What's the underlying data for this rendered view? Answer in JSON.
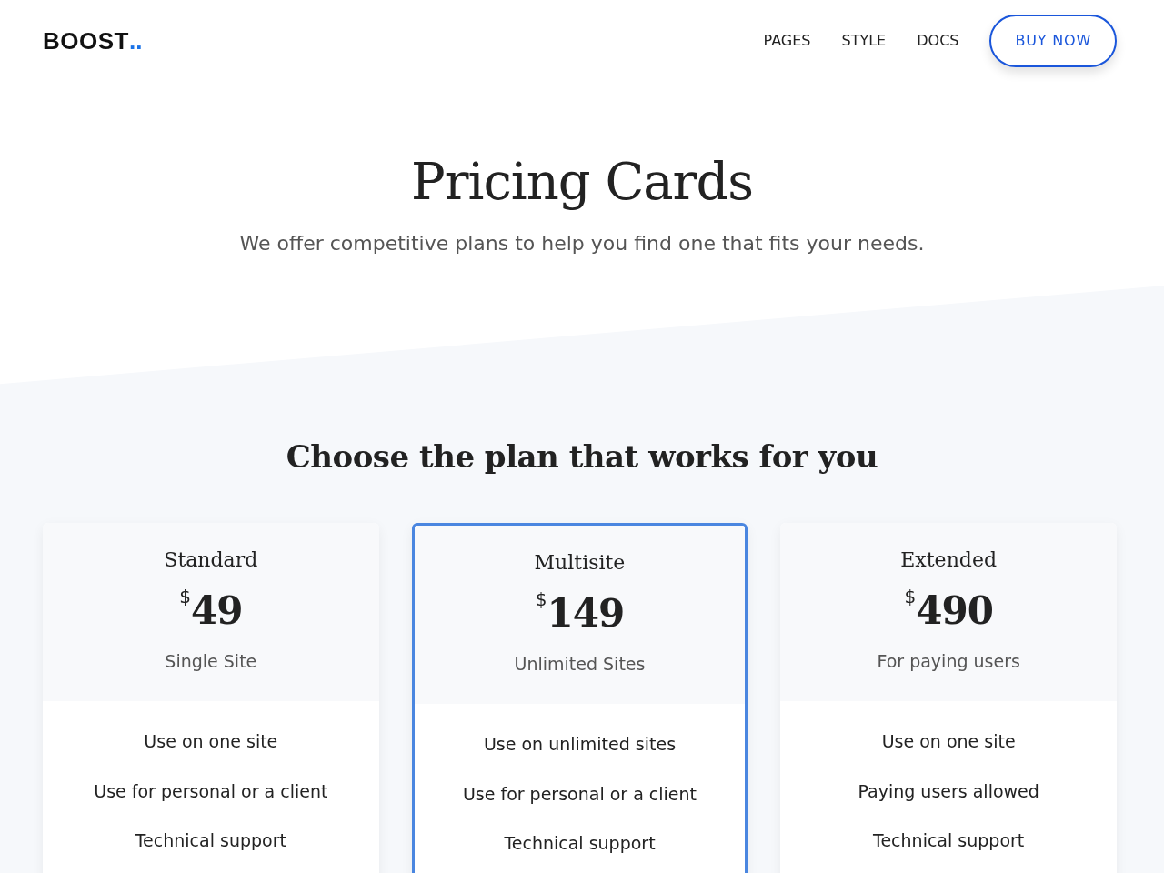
{
  "navbar": {
    "logo": "BOOST",
    "logo_dots": "..",
    "links": [
      "PAGES",
      "STYLE",
      "DOCS"
    ],
    "cta": "BUY NOW"
  },
  "hero": {
    "title": "Pricing Cards",
    "subtitle": "We offer competitive plans to help you find one that fits your needs."
  },
  "pricing": {
    "heading": "Choose the plan that works for you",
    "plans": [
      {
        "name": "Standard",
        "currency": "$",
        "price": "49",
        "caption": "Single Site",
        "featured": false,
        "features": [
          "Use on one site",
          "Use for personal or a client",
          "Technical support"
        ]
      },
      {
        "name": "Multisite",
        "currency": "$",
        "price": "149",
        "caption": "Unlimited Sites",
        "featured": true,
        "features": [
          "Use on unlimited sites",
          "Use for personal or a client",
          "Technical support"
        ]
      },
      {
        "name": "Extended",
        "currency": "$",
        "price": "490",
        "caption": "For paying users",
        "featured": false,
        "features": [
          "Use on one site",
          "Paying users allowed",
          "Technical support"
        ]
      }
    ]
  }
}
